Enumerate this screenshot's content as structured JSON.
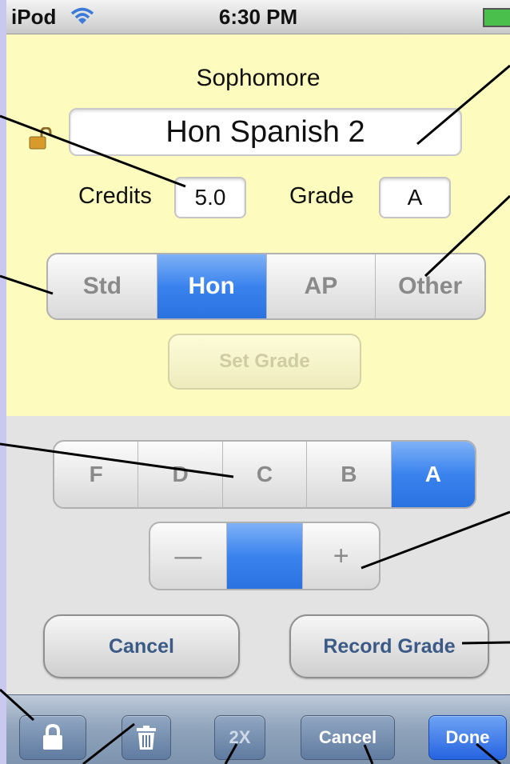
{
  "status_bar": {
    "carrier": "iPod",
    "time": "6:30 PM"
  },
  "course": {
    "class_level": "Sophomore",
    "name": "Hon Spanish 2",
    "credits_label": "Credits",
    "credits_value": "5.0",
    "grade_label": "Grade",
    "grade_value": "A"
  },
  "course_type": {
    "options": [
      "Std",
      "Hon",
      "AP",
      "Other"
    ],
    "selected": "Hon"
  },
  "set_grade_label": "Set Grade",
  "letter_grade": {
    "options": [
      "F",
      "D",
      "C",
      "B",
      "A"
    ],
    "selected": "A"
  },
  "modifier": {
    "minus": "—",
    "none": "",
    "plus": "+",
    "selected": "none"
  },
  "cancel_label": "Cancel",
  "record_grade_label": "Record Grade",
  "toolbar": {
    "lock": "lock-icon",
    "trash": "trash-icon",
    "double_label": "2X",
    "cancel_label": "Cancel",
    "done_label": "Done"
  },
  "colors": {
    "accent": "#2a72e0",
    "yellow_bg": "#fdfbbd",
    "toolbar": "#8ea2ba",
    "page_bg": "#c9c9ef"
  }
}
